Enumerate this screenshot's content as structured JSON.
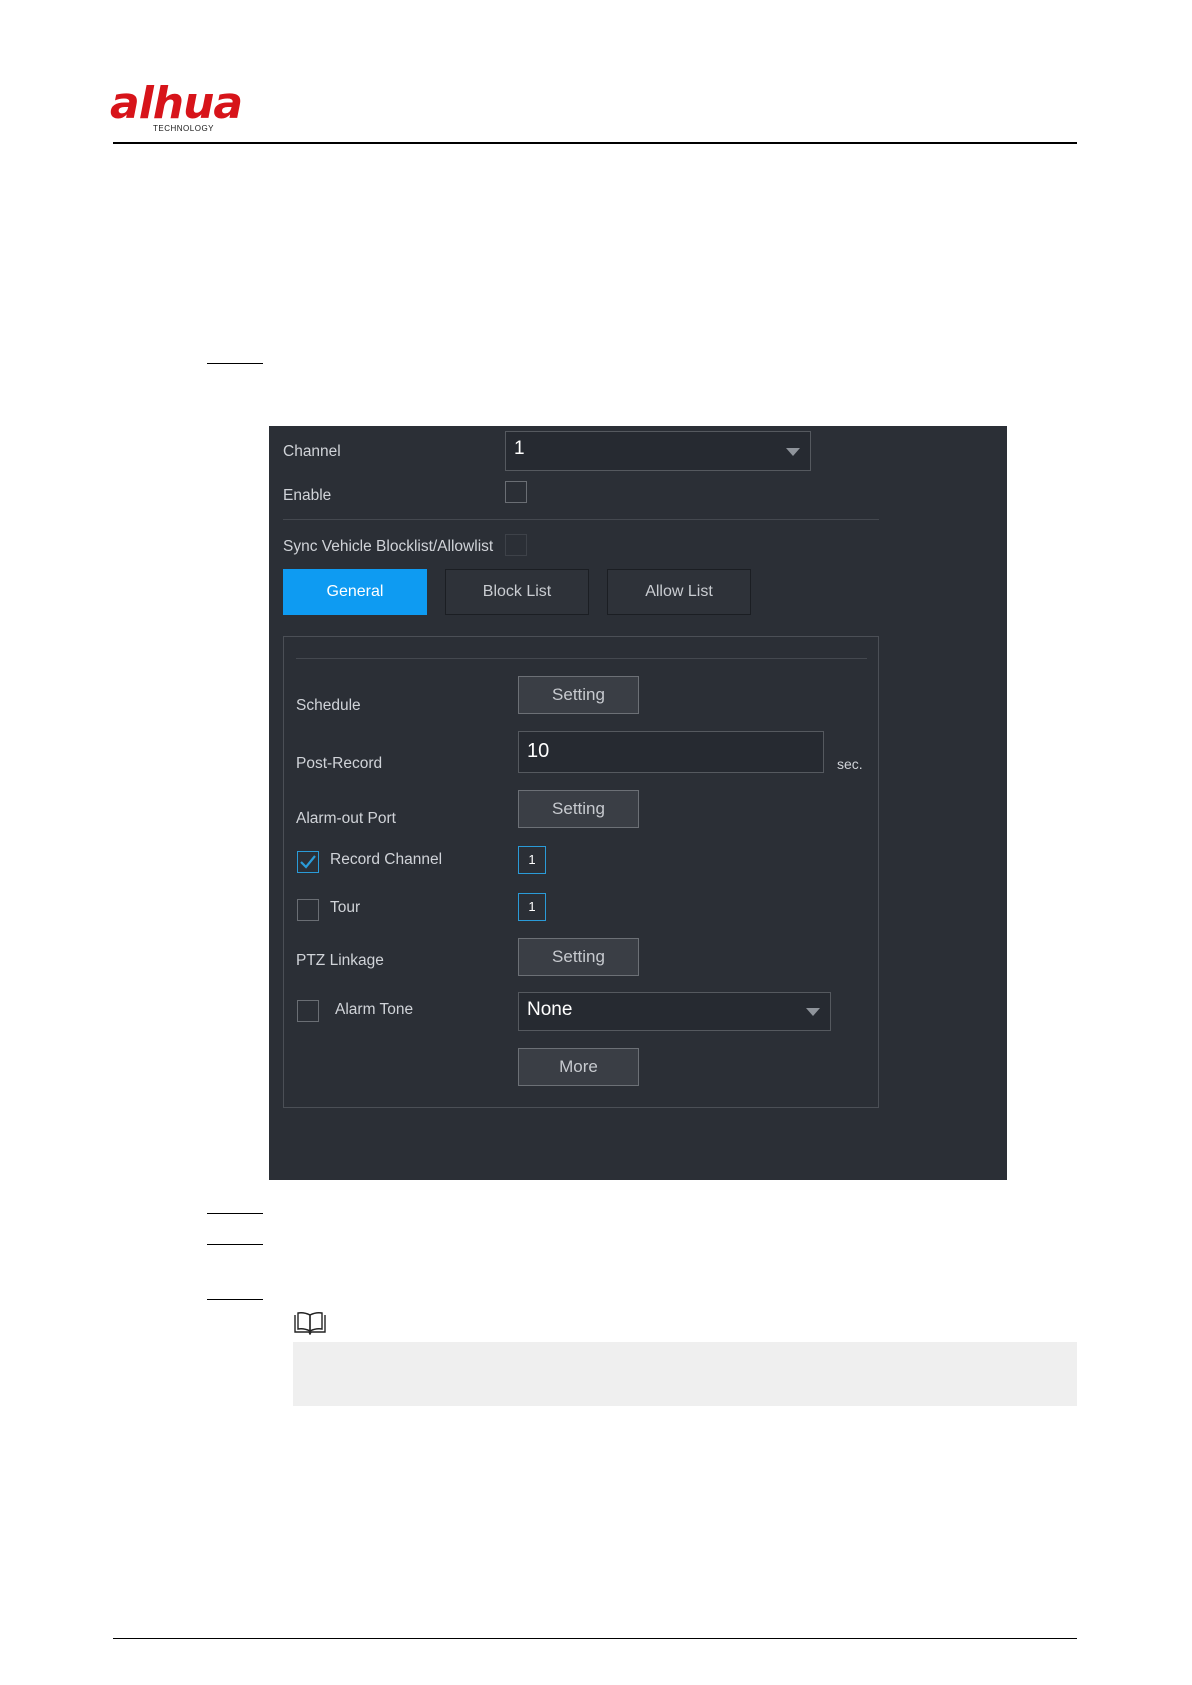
{
  "header": {
    "logo_text": "alhua",
    "logo_subtitle": "TECHNOLOGY"
  },
  "ui": {
    "channel_label": "Channel",
    "channel_value": "1",
    "enable_label": "Enable",
    "sync_label": "Sync Vehicle Blocklist/Allowlist",
    "tabs": [
      {
        "label": "General",
        "active": true
      },
      {
        "label": "Block List",
        "active": false
      },
      {
        "label": "Allow List",
        "active": false
      }
    ],
    "general": {
      "schedule_label": "Schedule",
      "schedule_button": "Setting",
      "post_record_label": "Post-Record",
      "post_record_value": "10",
      "post_record_unit": "sec.",
      "alarm_out_label": "Alarm-out Port",
      "alarm_out_button": "Setting",
      "record_channel_label": "Record Channel",
      "record_channel_checked": true,
      "record_channel_value": "1",
      "tour_label": "Tour",
      "tour_checked": false,
      "tour_value": "1",
      "ptz_label": "PTZ Linkage",
      "ptz_button": "Setting",
      "alarm_tone_label": "Alarm Tone",
      "alarm_tone_checked": false,
      "alarm_tone_value": "None",
      "more_button": "More"
    }
  },
  "colors": {
    "brand_red": "#d7141a",
    "accent_blue": "#0e9bf2",
    "panel_bg": "#2b2f36"
  }
}
